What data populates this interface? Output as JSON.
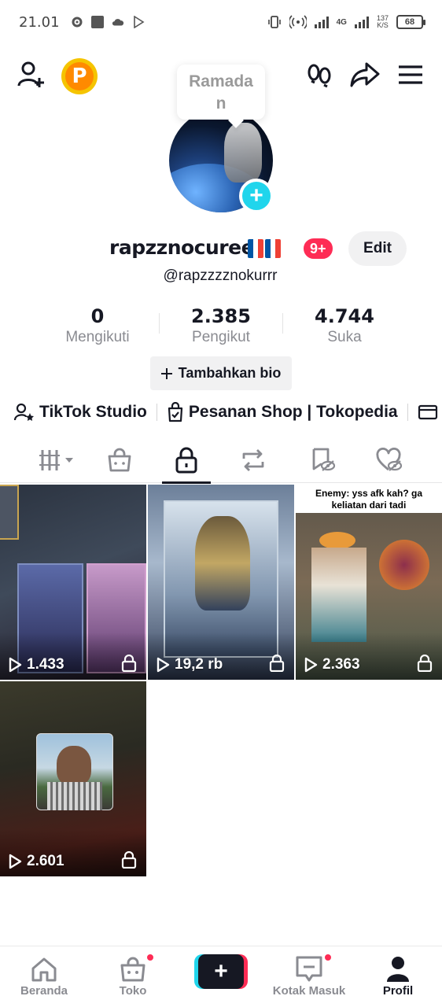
{
  "status_bar": {
    "time": "21.01",
    "network_type": "4G",
    "net_speed_value": "137",
    "net_speed_unit": "K/S",
    "battery": "68"
  },
  "profile": {
    "note_bubble": "Ramadan",
    "username": "rapzznocuree",
    "flags": "🇫🇷🇫🇷",
    "notification_badge": "9+",
    "edit_label": "Edit",
    "handle": "@rapzzzznokurrr"
  },
  "stats": [
    {
      "value": "0",
      "label": "Mengikuti"
    },
    {
      "value": "2.385",
      "label": "Pengikut"
    },
    {
      "value": "4.744",
      "label": "Suka"
    }
  ],
  "bio_button": "Tambahkan bio",
  "links": {
    "studio": "TikTok Studio",
    "shop": "Pesanan Shop | Tokopedia"
  },
  "tabs": [
    "videos",
    "shop",
    "private",
    "reposts",
    "favorites",
    "liked"
  ],
  "active_tab": "private",
  "videos": [
    {
      "views": "1.433",
      "locked": true,
      "caption": ""
    },
    {
      "views": "19,2 rb",
      "locked": true,
      "caption": ""
    },
    {
      "views": "2.363",
      "locked": true,
      "caption": "Enemy: yss afk kah? ga keliatan dari tadi"
    },
    {
      "views": "2.601",
      "locked": true,
      "caption": ""
    }
  ],
  "bottom_nav": {
    "home": "Beranda",
    "shop": "Toko",
    "inbox": "Kotak Masuk",
    "profile": "Profil"
  },
  "colors": {
    "accent_red": "#fe2c55",
    "accent_cyan": "#20d5ec",
    "text_primary": "#161823",
    "text_secondary": "#8a8b91"
  }
}
